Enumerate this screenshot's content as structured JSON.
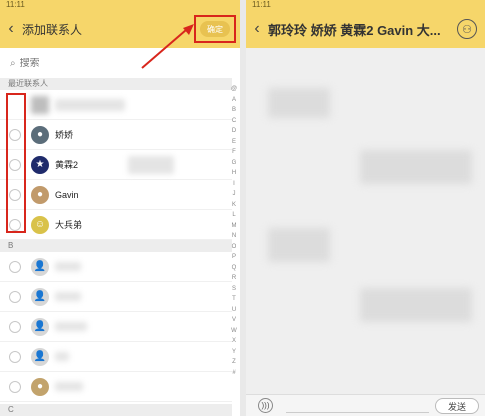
{
  "status_bar": {
    "time": "11:11"
  },
  "left": {
    "title": "添加联系人",
    "confirm_label": "确定",
    "search_placeholder": "搜索",
    "recent_header": "最近联系人",
    "recent_contacts": [
      {
        "name": "娇娇",
        "avatar_color": "#5b6d7a"
      },
      {
        "name": "黄霖2",
        "avatar_color": "#1f2b6b"
      },
      {
        "name": "Gavin",
        "avatar_color": "#c19a6b"
      },
      {
        "name": "大兵弟",
        "avatar_color": "#d9c24a"
      }
    ],
    "section_b": "B",
    "section_c": "C",
    "index_letters": [
      "@",
      "A",
      "B",
      "C",
      "D",
      "E",
      "F",
      "G",
      "H",
      "I",
      "J",
      "K",
      "L",
      "M",
      "N",
      "O",
      "P",
      "Q",
      "R",
      "S",
      "T",
      "U",
      "V",
      "W",
      "X",
      "Y",
      "Z",
      "#"
    ]
  },
  "right": {
    "title": "郭玲玲 娇娇 黄霖2 Gavin 大...",
    "send_label": "发送"
  },
  "colors": {
    "header_yellow": "#f6d66a",
    "confirm_yellow": "#e8c251",
    "highlight_red": "#d8261c"
  }
}
